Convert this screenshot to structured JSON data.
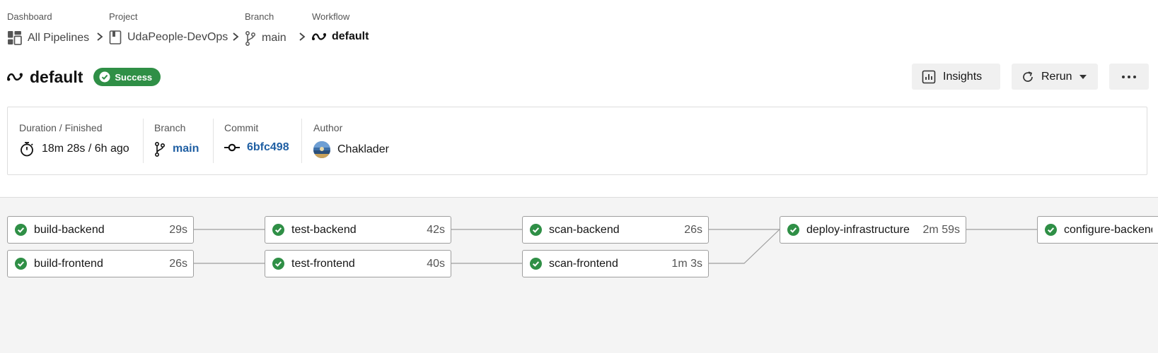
{
  "breadcrumbs": {
    "dashboard": {
      "label": "Dashboard",
      "value": "All Pipelines"
    },
    "project": {
      "label": "Project",
      "value": "UdaPeople-DevOps"
    },
    "branch": {
      "label": "Branch",
      "value": "main"
    },
    "workflow": {
      "label": "Workflow",
      "value": "default"
    }
  },
  "header": {
    "title": "default",
    "status": "Success",
    "status_color": "#2f8f46"
  },
  "actions": {
    "insights": "Insights",
    "rerun": "Rerun",
    "more_icon": "ellipsis-icon"
  },
  "info": {
    "duration": {
      "label": "Duration / Finished",
      "value": "18m 28s / 6h ago"
    },
    "branch": {
      "label": "Branch",
      "value": "main"
    },
    "commit": {
      "label": "Commit",
      "value": "6bfc498"
    },
    "author": {
      "label": "Author",
      "value": "Chaklader"
    }
  },
  "jobs": [
    {
      "name": "build-backend",
      "duration": "29s",
      "status": "success"
    },
    {
      "name": "build-frontend",
      "duration": "26s",
      "status": "success"
    },
    {
      "name": "test-backend",
      "duration": "42s",
      "status": "success"
    },
    {
      "name": "test-frontend",
      "duration": "40s",
      "status": "success"
    },
    {
      "name": "scan-backend",
      "duration": "26s",
      "status": "success"
    },
    {
      "name": "scan-frontend",
      "duration": "1m 3s",
      "status": "success"
    },
    {
      "name": "deploy-infrastructure",
      "duration": "2m 59s",
      "status": "success"
    },
    {
      "name": "configure-backend-",
      "duration": "",
      "status": "success"
    }
  ],
  "colors": {
    "link": "#1f5fa3",
    "success": "#2f8f46"
  }
}
